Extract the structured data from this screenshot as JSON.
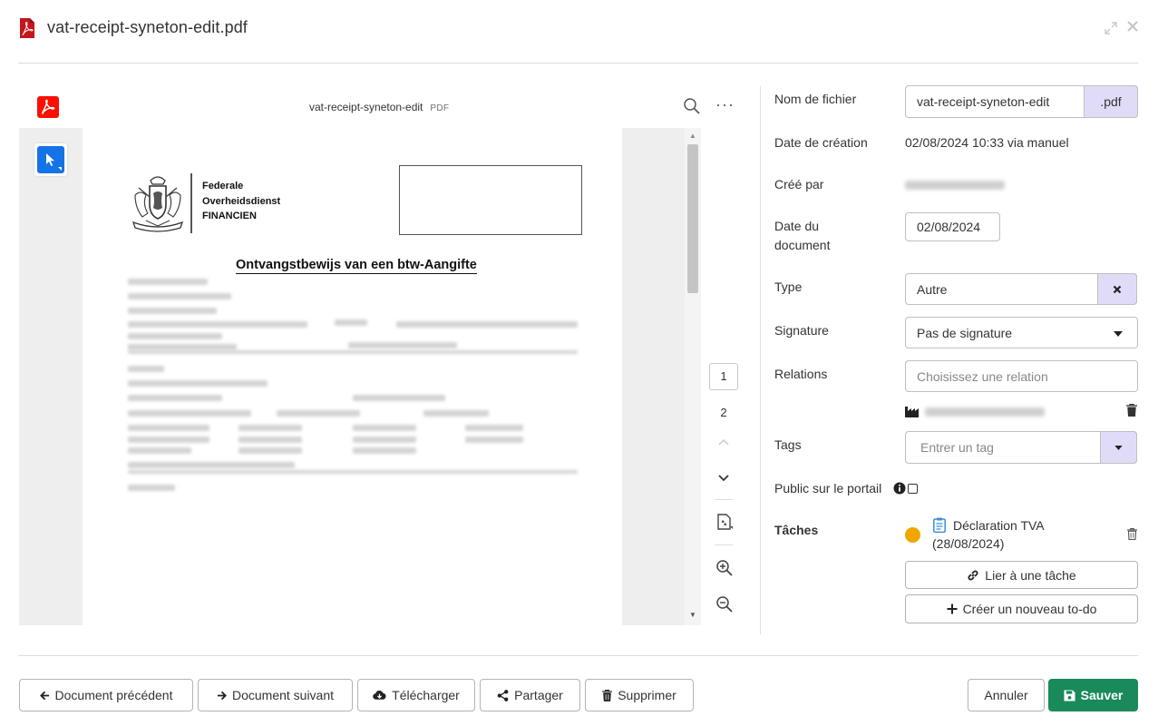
{
  "header": {
    "title": "vat-receipt-syneton-edit.pdf"
  },
  "viewer": {
    "file_name": "vat-receipt-syneton-edit",
    "file_type": "PDF",
    "current_page": "1",
    "total_pages": "2",
    "document": {
      "org_line1": "Federale",
      "org_line2": "Overheidsdienst",
      "org_line3": "FINANCIEN",
      "title": "Ontvangstbewijs van een btw-Aangifte"
    }
  },
  "form": {
    "filename_label": "Nom de fichier",
    "filename_value": "vat-receipt-syneton-edit",
    "filename_ext": ".pdf",
    "created_date_label": "Date de création",
    "created_date_value": "02/08/2024 10:33 via manuel",
    "created_by_label": "Créé par",
    "doc_date_label_line1": "Date du",
    "doc_date_label_line2": "document",
    "doc_date_value": "02/08/2024",
    "type_label": "Type",
    "type_value": "Autre",
    "signature_label": "Signature",
    "signature_value": "Pas de signature",
    "relations_label": "Relations",
    "relations_placeholder": "Choisissez une relation",
    "tags_label": "Tags",
    "tags_placeholder": "Entrer un tag",
    "public_label": "Public sur le portail",
    "tasks_label": "Tâches",
    "task_title": "Déclaration TVA",
    "task_date": "(28/08/2024)",
    "link_task_label": "Lier à une tâche",
    "new_todo_label": "Créer un nouveau to-do",
    "colors": {
      "accent": "#e0dcf8",
      "task_status": "#f0a500",
      "primary": "#1a8a5a"
    }
  },
  "footer": {
    "prev_label": "Document précédent",
    "next_label": "Document suivant",
    "download_label": "Télécharger",
    "share_label": "Partager",
    "delete_label": "Supprimer",
    "cancel_label": "Annuler",
    "save_label": "Sauver"
  }
}
